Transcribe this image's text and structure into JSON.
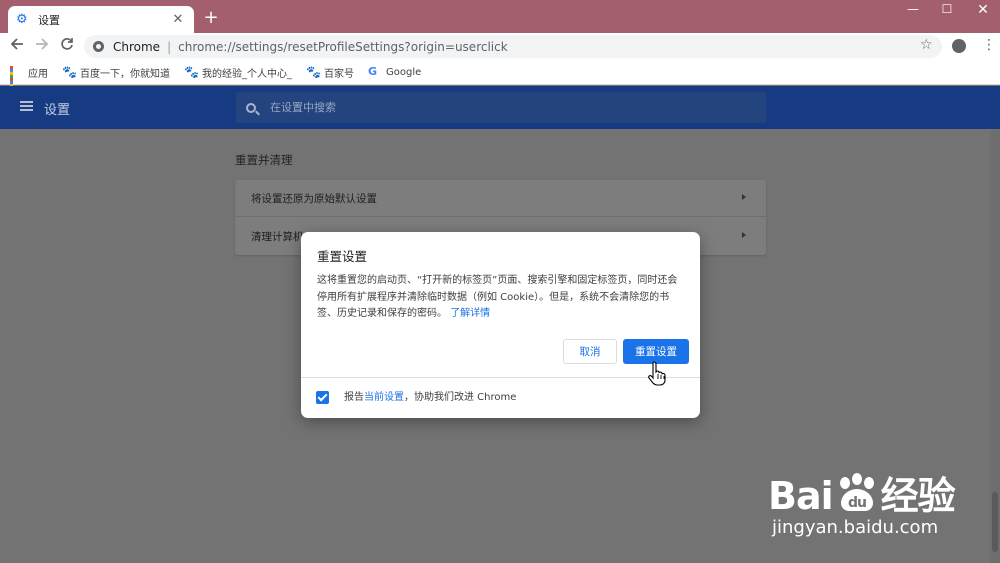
{
  "window": {
    "tab_title": "设置",
    "new_tab": "+",
    "minimize": "—",
    "maximize": "☐",
    "close": "✕"
  },
  "toolbar": {
    "origin": "Chrome",
    "separator": "|",
    "url": "chrome://settings/resetProfileSettings?origin=userclick"
  },
  "bookmarks": [
    {
      "label": "应用",
      "icon": "apps-icon"
    },
    {
      "label": "百度一下，你就知道",
      "icon": "baidu-paw-icon"
    },
    {
      "label": "我的经验_个人中心_",
      "icon": "baidu-paw-icon"
    },
    {
      "label": "百家号",
      "icon": "baidu-paw-icon"
    },
    {
      "label": "Google",
      "icon": "google-icon"
    }
  ],
  "settings_header": {
    "title": "设置",
    "search_placeholder": "在设置中搜索"
  },
  "page": {
    "section_title": "重置并清理",
    "rows": [
      {
        "label": "将设置还原为原始默认设置"
      },
      {
        "label": "清理计算机"
      }
    ]
  },
  "dialog": {
    "title": "重置设置",
    "body": "这将重置您的启动页、“打开新的标签页”页面、搜索引擎和固定标签页，同时还会停用所有扩展程序并清除临时数据（例如 Cookie）。但是，系统不会清除您的书签、历史记录和保存的密码。",
    "learn_more": "了解详情",
    "cancel_label": "取消",
    "reset_label": "重置设置",
    "report_prefix": "报告",
    "report_link": "当前设置",
    "report_suffix": "，协助我们改进 Chrome",
    "report_checked": true
  },
  "watermark": {
    "logo_text": "Bai",
    "logo_text2": "经验",
    "domain": "jingyan.baidu.com"
  },
  "colors": {
    "titlebar": "#a35f6e",
    "settings_header": "#173b82",
    "accent": "#1a73e8"
  }
}
